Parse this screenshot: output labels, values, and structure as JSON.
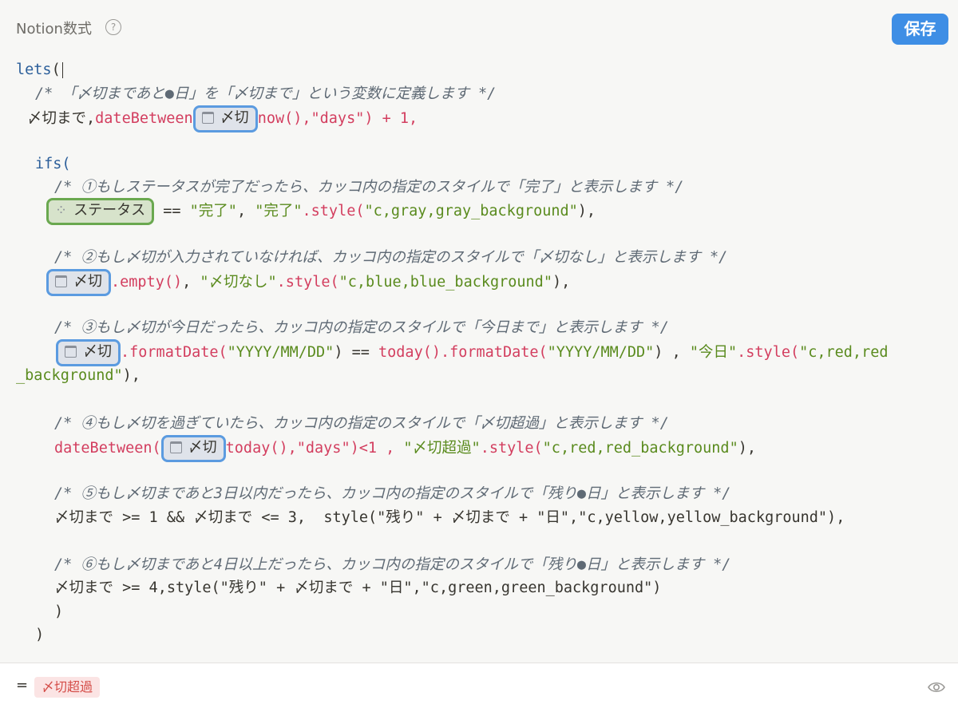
{
  "header": {
    "title": "Notion数式",
    "help": "?",
    "save": "保存"
  },
  "code": {
    "lets": "lets",
    "open_paren": "(",
    "comment0": "/* 「〆切まであと●日」を「〆切まで」という変数に定義します */",
    "var_name": "〆切まで",
    "dateBetween": "dateBetween",
    "deadline": "〆切",
    "now_args": "now(),\"days\") + 1,",
    "ifs": "ifs(",
    "comment1": "/* ①もしステータスが完了だったら、カッコ内の指定のスタイルで「完了」と表示します */",
    "status": "ステータス",
    "line1_rest_op": " == ",
    "line1_str1": "\"完了\"",
    "line1_sep": ", ",
    "line1_str2": "\"完了\"",
    "line1_style": ".style(",
    "line1_arg": "\"c,gray,gray_background\"",
    "line1_end": "),",
    "comment2": "/* ②もし〆切が入力されていなければ、カッコ内の指定のスタイルで「〆切なし」と表示します */",
    "line2_fn": ".empty()",
    "line2_sep": ", ",
    "line2_str": "\"〆切なし\"",
    "line2_style": ".style(",
    "line2_arg": "\"c,blue,blue_background\"",
    "line2_end": "),",
    "comment3": "/* ③もし〆切が今日だったら、カッコ内の指定のスタイルで「今日まで」と表示します */",
    "line3_fmt1": ".formatDate(",
    "line3_arg1": "\"YYYY/MM/DD\"",
    "line3_eq": ") == ",
    "line3_today": "today().formatDate(",
    "line3_arg2": "\"YYYY/MM/DD\"",
    "line3_mid": ") , ",
    "line3_str": "\"今日\"",
    "line3_style": ".style(",
    "line3_arg3a": "\"c,red,red",
    "line3_arg3b": "_background\"",
    "line3_end": "),",
    "comment4": "/* ④もし〆切を過ぎていたら、カッコ内の指定のスタイルで「〆切超過」と表示します */",
    "line4_fn": "dateBetween(",
    "line4_rest1": "today(),\"days\")<1 , ",
    "line4_str": "\"〆切超過\"",
    "line4_style": ".style(",
    "line4_arg": "\"c,red,red_background\"",
    "line4_end": "),",
    "comment5": "/* ⑤もし〆切まであと3日以内だったら、カッコ内の指定のスタイルで「残り●日」と表示します */",
    "line5": "〆切まで >= 1 && 〆切まで <= 3,  style(\"残り\" + 〆切まで + \"日\",\"c,yellow,yellow_background\"),",
    "comment6": "/* ⑥もし〆切まであと4日以上だったら、カッコ内の指定のスタイルで「残り●日」と表示します */",
    "line6": "〆切まで >= 4,style(\"残り\" + 〆切まで + \"日\",\"c,green,green_background\")",
    "close_inner": ")",
    "close_outer": ")"
  },
  "result": {
    "eq": "=",
    "value": "〆切超過"
  },
  "icons": {
    "calendar": "calendar-icon",
    "status": "status-icon",
    "eye": "eye-icon",
    "help": "help-icon"
  }
}
